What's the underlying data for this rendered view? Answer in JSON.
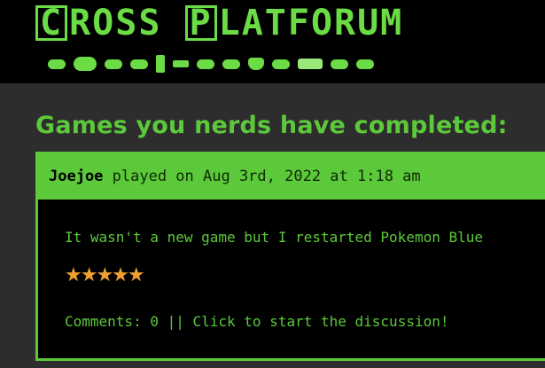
{
  "site": {
    "logo_first": "C",
    "logo_first_rest": "ROSS ",
    "logo_second": "P",
    "logo_second_rest": "LATFORUM",
    "colors": {
      "accent": "#5cc93b",
      "background": "#2d2d2d",
      "header": "#000000",
      "star": "#f0a030"
    },
    "controller_icons": [
      "psx-controller-icon",
      "xbox-controller-icon",
      "gamecube-controller-icon",
      "snes-controller-icon",
      "wii-remote-icon",
      "gba-icon",
      "nes-controller-icon",
      "ps2-controller-icon",
      "n64-controller-icon",
      "ps3-controller-icon",
      "switch-icon",
      "xbox360-controller-icon",
      "ps4-controller-icon"
    ]
  },
  "main": {
    "title": "Games you nerds have completed:"
  },
  "post": {
    "user": "Joejoe",
    "meta": " played on Aug 3rd, 2022 at 1:18 am",
    "text": "It wasn't a new game but I restarted Pokemon Blue",
    "rating": 5,
    "rating_stars": "★★★★★",
    "comments_label": "Comments: 0 || ",
    "discussion_link": "Click to start the discussion!"
  }
}
